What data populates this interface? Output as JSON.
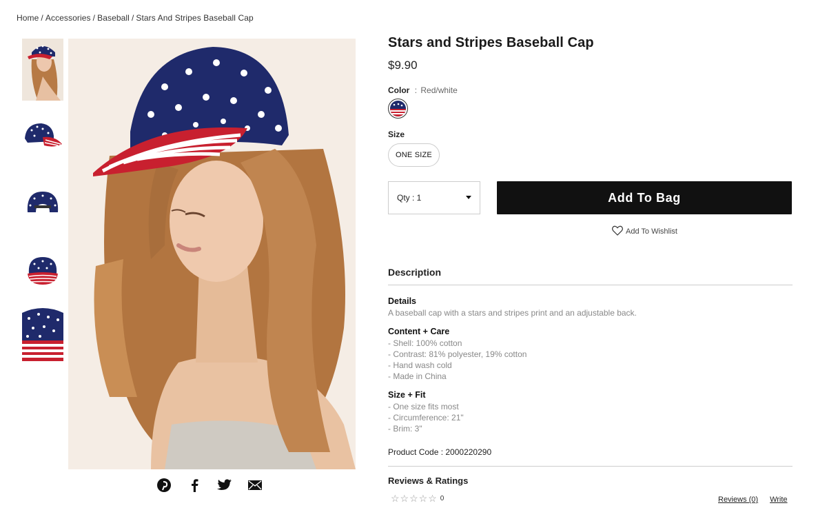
{
  "breadcrumb": {
    "items": [
      "Home",
      "Accessories",
      "Baseball",
      "Stars And Stripes Baseball Cap"
    ],
    "separator": "/"
  },
  "gallery": {
    "thumbnails": [
      "model-with-cap",
      "cap-side-view",
      "cap-back-view",
      "cap-front-view",
      "cap-closeup"
    ],
    "share_icons": [
      "pinterest-icon",
      "facebook-icon",
      "twitter-icon",
      "email-icon"
    ]
  },
  "product": {
    "title": "Stars and Stripes Baseball Cap",
    "price": "$9.90",
    "color_label": "Color",
    "color_sep": ":",
    "color_value": "Red/white",
    "size_label": "Size",
    "size_option": "ONE SIZE",
    "qty_label": "Qty : 1",
    "add_to_bag": "Add To Bag",
    "wishlist": "Add To Wishlist"
  },
  "description": {
    "heading": "Description",
    "details_title": "Details",
    "details_text": "A baseball cap with a stars and stripes print and an adjustable back.",
    "care_title": "Content + Care",
    "care_items": [
      "- Shell: 100% cotton",
      "- Contrast: 81% polyester, 19% cotton",
      "- Hand wash cold",
      "- Made in China"
    ],
    "fit_title": "Size + Fit",
    "fit_items": [
      "- One size fits most",
      "- Circumference: 21\"",
      "- Brim: 3\""
    ],
    "product_code": "Product Code : 2000220290"
  },
  "reviews": {
    "heading": "Reviews & Ratings",
    "stars": "☆☆☆☆☆",
    "count": "0",
    "reviews_link": "Reviews (0)",
    "write_link": "Write"
  },
  "colors": {
    "navy": "#1f2a6b",
    "red": "#c8202f",
    "button_black": "#111111"
  }
}
